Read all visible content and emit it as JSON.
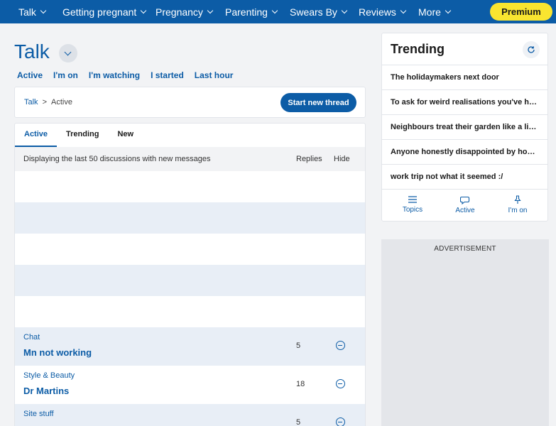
{
  "nav": {
    "items": [
      {
        "label": "Talk"
      },
      {
        "label": "Getting pregnant"
      },
      {
        "label": "Pregnancy"
      },
      {
        "label": "Parenting"
      },
      {
        "label": "Swears By"
      },
      {
        "label": "Reviews"
      },
      {
        "label": "More"
      }
    ],
    "premium_label": "Premium"
  },
  "page": {
    "title": "Talk",
    "subnav": [
      "Active",
      "I'm on",
      "I'm watching",
      "I started",
      "Last hour"
    ]
  },
  "breadcrumb": {
    "root": "Talk",
    "separator": ">",
    "current": "Active",
    "start_thread_label": "Start new thread"
  },
  "list": {
    "tabs": [
      "Active",
      "Trending",
      "New"
    ],
    "active_tab": "Active",
    "header": {
      "description": "Displaying the last 50 discussions with new messages",
      "replies": "Replies",
      "hide": "Hide"
    },
    "threads": [
      {
        "category": "Chat",
        "title": "Mn not working",
        "replies": "5"
      },
      {
        "category": "Style & Beauty",
        "title": "Dr Martins",
        "replies": "18"
      },
      {
        "category": "Site stuff",
        "title": "",
        "replies": "5"
      }
    ]
  },
  "trending": {
    "title": "Trending",
    "items": [
      "The holidaymakers next door",
      "To ask for weird realisations you've had a...",
      "Neighbours treat their garden like a livin...",
      "Anyone honestly disappointed by how th...",
      "work trip not what it seemed :/"
    ],
    "footer": {
      "topics": "Topics",
      "active": "Active",
      "im_on": "I'm on"
    }
  },
  "ad": {
    "label": "ADVERTISEMENT"
  },
  "colors": {
    "brand_blue": "#0c5ca6",
    "premium_yellow": "#f9e530",
    "row_alt": "#e8eef6"
  }
}
